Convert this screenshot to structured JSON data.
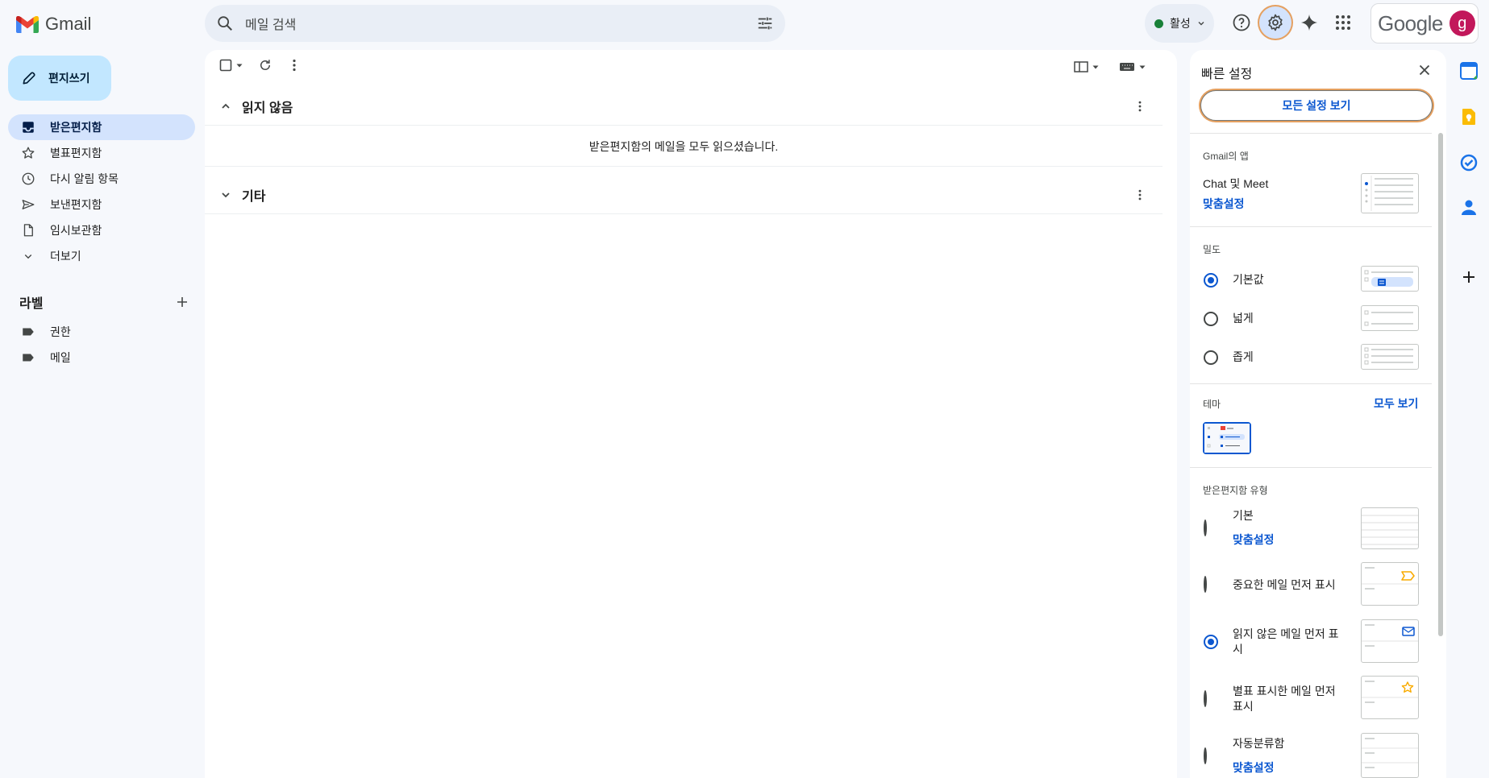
{
  "app": {
    "name": "Gmail"
  },
  "search": {
    "placeholder": "메일 검색"
  },
  "header": {
    "status": "활성",
    "account_brand": "Google",
    "avatar_letter": "g"
  },
  "compose": {
    "label": "편지쓰기"
  },
  "nav": [
    {
      "label": "받은편지함",
      "icon": "inbox-icon",
      "active": true
    },
    {
      "label": "별표편지함",
      "icon": "star-icon"
    },
    {
      "label": "다시 알림 항목",
      "icon": "clock-icon"
    },
    {
      "label": "보낸편지함",
      "icon": "send-icon"
    },
    {
      "label": "임시보관함",
      "icon": "file-icon"
    },
    {
      "label": "더보기",
      "icon": "chevron-down-icon"
    }
  ],
  "labels": {
    "title": "라벨",
    "items": [
      "권한",
      "메일"
    ]
  },
  "main": {
    "sections": [
      {
        "title": "읽지 않음",
        "expanded": true,
        "empty_message": "받은편지함의 메일을 모두 읽으셨습니다."
      },
      {
        "title": "기타",
        "expanded": false
      }
    ]
  },
  "quick_settings": {
    "title": "빠른 설정",
    "all_settings_button": "모든 설정 보기",
    "apps": {
      "heading": "Gmail의 앱",
      "item": "Chat 및 Meet",
      "customize": "맞춤설정"
    },
    "density": {
      "heading": "밀도",
      "options": [
        {
          "label": "기본값",
          "selected": true
        },
        {
          "label": "넓게",
          "selected": false
        },
        {
          "label": "좁게",
          "selected": false
        }
      ]
    },
    "theme": {
      "heading": "테마",
      "see_all": "모두 보기"
    },
    "inbox_type": {
      "heading": "받은편지함 유형",
      "options": [
        {
          "label": "기본",
          "customize": "맞춤설정",
          "selected": false
        },
        {
          "label": "중요한 메일 먼저 표시",
          "selected": false
        },
        {
          "label": "읽지 않은 메일 먼저 표시",
          "selected": true
        },
        {
          "label": "별표 표시한 메일 먼저 표시",
          "selected": false
        },
        {
          "label": "자동분류함",
          "customize": "맞춤설정",
          "selected": false
        }
      ]
    }
  },
  "colors": {
    "accent": "#0b57d0",
    "compose_bg": "#c2e7ff",
    "active_nav": "#d3e3fd",
    "avatar": "#c2185b",
    "status_green": "#188038"
  }
}
